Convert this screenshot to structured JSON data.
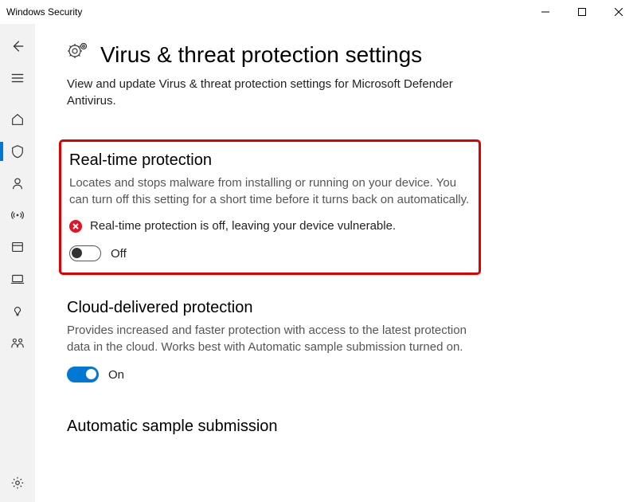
{
  "window": {
    "title": "Windows Security"
  },
  "page": {
    "title": "Virus & threat protection settings",
    "description": "View and update Virus & threat protection settings for Microsoft Defender Antivirus."
  },
  "sections": {
    "realtime": {
      "title": "Real-time protection",
      "description": "Locates and stops malware from installing or running on your device. You can turn off this setting for a short time before it turns back on automatically.",
      "warning": "Real-time protection is off, leaving your device vulnerable.",
      "toggle_label": "Off"
    },
    "cloud": {
      "title": "Cloud-delivered protection",
      "description": "Provides increased and faster protection with access to the latest protection data in the cloud. Works best with Automatic sample submission turned on.",
      "toggle_label": "On"
    },
    "autosample": {
      "title": "Automatic sample submission"
    }
  }
}
